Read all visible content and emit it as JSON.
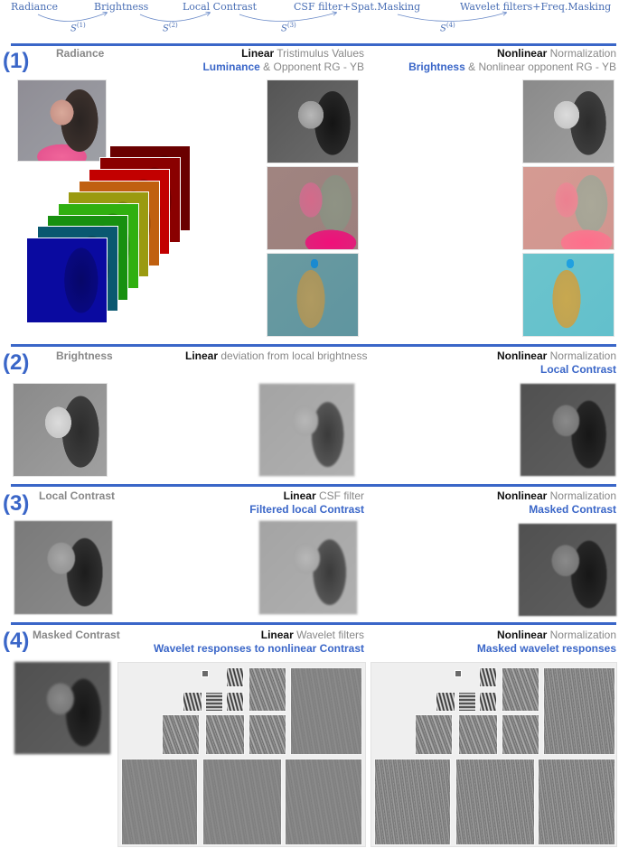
{
  "pipeline": {
    "stages": [
      "Radiance",
      "Brightness",
      "Local Contrast",
      "CSF filter+Spat.Masking",
      "Wavelet filters+Freq.Masking"
    ],
    "transforms": [
      {
        "symbol": "S",
        "index": "(1)"
      },
      {
        "symbol": "S",
        "index": "(2)"
      },
      {
        "symbol": "S",
        "index": "(3)"
      },
      {
        "symbol": "S",
        "index": "(4)"
      }
    ]
  },
  "sections": [
    {
      "number": "(1)",
      "input_label": "Radiance",
      "linear": {
        "keyword": "Linear",
        "desc": "Tristimulus Values",
        "output_strong": "Luminance",
        "output_rest": " & Opponent RG - YB"
      },
      "nonlinear": {
        "keyword": "Nonlinear",
        "desc": "Normalization",
        "output_strong": "Brightness",
        "output_rest": " & Nonlinear opponent RG - YB"
      },
      "spectral_bands": 9
    },
    {
      "number": "(2)",
      "input_label": "Brightness",
      "linear": {
        "keyword": "Linear",
        "desc": "deviation from local brightness"
      },
      "nonlinear": {
        "keyword": "Nonlinear",
        "desc": "Normalization",
        "output_strong": "Local Contrast"
      }
    },
    {
      "number": "(3)",
      "input_label": "Local Contrast",
      "linear": {
        "keyword": "Linear",
        "desc": "CSF filter",
        "output_strong": "Filtered local Contrast"
      },
      "nonlinear": {
        "keyword": "Nonlinear",
        "desc": "Normalization",
        "output_strong": "Masked Contrast"
      }
    },
    {
      "number": "(4)",
      "input_label": "Masked Contrast",
      "linear": {
        "keyword": "Linear",
        "desc": "Wavelet filters",
        "output_strong": "Wavelet responses to nonlinear Contrast"
      },
      "nonlinear": {
        "keyword": "Nonlinear",
        "desc": "Normalization",
        "output_strong": "Masked wavelet responses"
      }
    }
  ],
  "colors": {
    "accent": "#3a66c8",
    "pipeline_text": "#4a6fb5",
    "muted_text": "#888888",
    "strong_text": "#111111"
  }
}
